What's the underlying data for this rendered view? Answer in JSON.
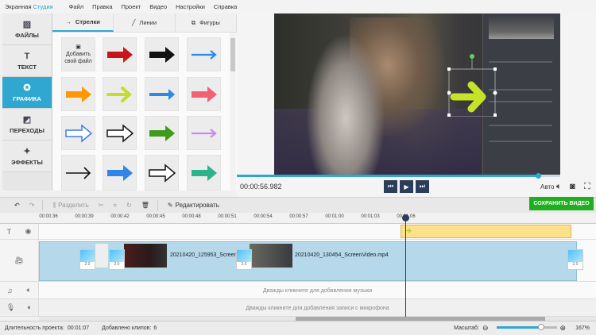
{
  "app": {
    "title_part1": "Экранная",
    "title_part2": "Студия"
  },
  "menu": [
    "Файл",
    "Правка",
    "Проект",
    "Видео",
    "Настройки",
    "Справка"
  ],
  "sidebar": [
    {
      "label": "ФАЙЛЫ",
      "icon": "image-icon",
      "glyph": "▨"
    },
    {
      "label": "ТЕКСТ",
      "icon": "text-icon",
      "glyph": "T"
    },
    {
      "label": "ГРАФИКА",
      "icon": "star-icon",
      "glyph": "✪",
      "active": true
    },
    {
      "label": "ПЕРЕХОДЫ",
      "icon": "transitions-icon",
      "glyph": "◩"
    },
    {
      "label": "ЭФФЕКТЫ",
      "icon": "magic-wand-icon",
      "glyph": "✦"
    }
  ],
  "panel": {
    "tabs": [
      {
        "label": "Стрелки",
        "glyph": "→",
        "active": true
      },
      {
        "label": "Линии",
        "glyph": "╱"
      },
      {
        "label": "Фигуры",
        "glyph": "⧉"
      }
    ],
    "add_file": "Добавить свой файл",
    "arrows": [
      {
        "style": "block",
        "color": "#c8151b"
      },
      {
        "style": "block",
        "color": "#111111"
      },
      {
        "style": "line",
        "color": "#2f86e8"
      },
      {
        "style": "block",
        "color": "#ff9800"
      },
      {
        "style": "chevron",
        "color": "#c6dc2a"
      },
      {
        "style": "line-thick",
        "color": "#2f86e8"
      },
      {
        "style": "block",
        "color": "#f06272"
      },
      {
        "style": "outline",
        "color": "#3f7de8"
      },
      {
        "style": "outline",
        "color": "#111111"
      },
      {
        "style": "block",
        "color": "#3f9b1c"
      },
      {
        "style": "line",
        "color": "#c28cf0"
      },
      {
        "style": "line-thin",
        "color": "#111111"
      },
      {
        "style": "block",
        "color": "#2f86e8"
      },
      {
        "style": "outline",
        "color": "#111111"
      },
      {
        "style": "block",
        "color": "#2bb38a"
      }
    ]
  },
  "player": {
    "time": "00:00:56.982",
    "progress_percent": 93,
    "quality": "Авто"
  },
  "toolbar": {
    "split": "Разделить",
    "edit": "Редактировать",
    "save": "СОХРАНИТЬ ВИДЕО"
  },
  "ruler": [
    "00:00:36",
    "00:00:39",
    "00:00:42",
    "00:00:45",
    "00:00:48",
    "00:00:51",
    "00:00:54",
    "00:00:57",
    "00:01:00",
    "00:01:03",
    "00:01:06"
  ],
  "timeline": {
    "clip1": "20210420_125953_ScreenV",
    "clip2": "20210420_130454_ScreenVideo.mp4",
    "transition_duration": "2.0",
    "music_hint": "Дважды кликните для добавления музыки",
    "mic_hint": "Дважды кликните для добавления записи с микрофона"
  },
  "status": {
    "duration_label": "Длительность проекта:",
    "duration": "00:01:07",
    "clips_label": "Добавлено клипов:",
    "clips": "6",
    "scale_label": "Масштаб:",
    "scale": "167%",
    "scale_percent": 74
  },
  "colors": {
    "accent": "#2fa7d0",
    "save": "#1fae1f",
    "clip": "#b5d8ea",
    "text_clip": "#fde08a"
  }
}
